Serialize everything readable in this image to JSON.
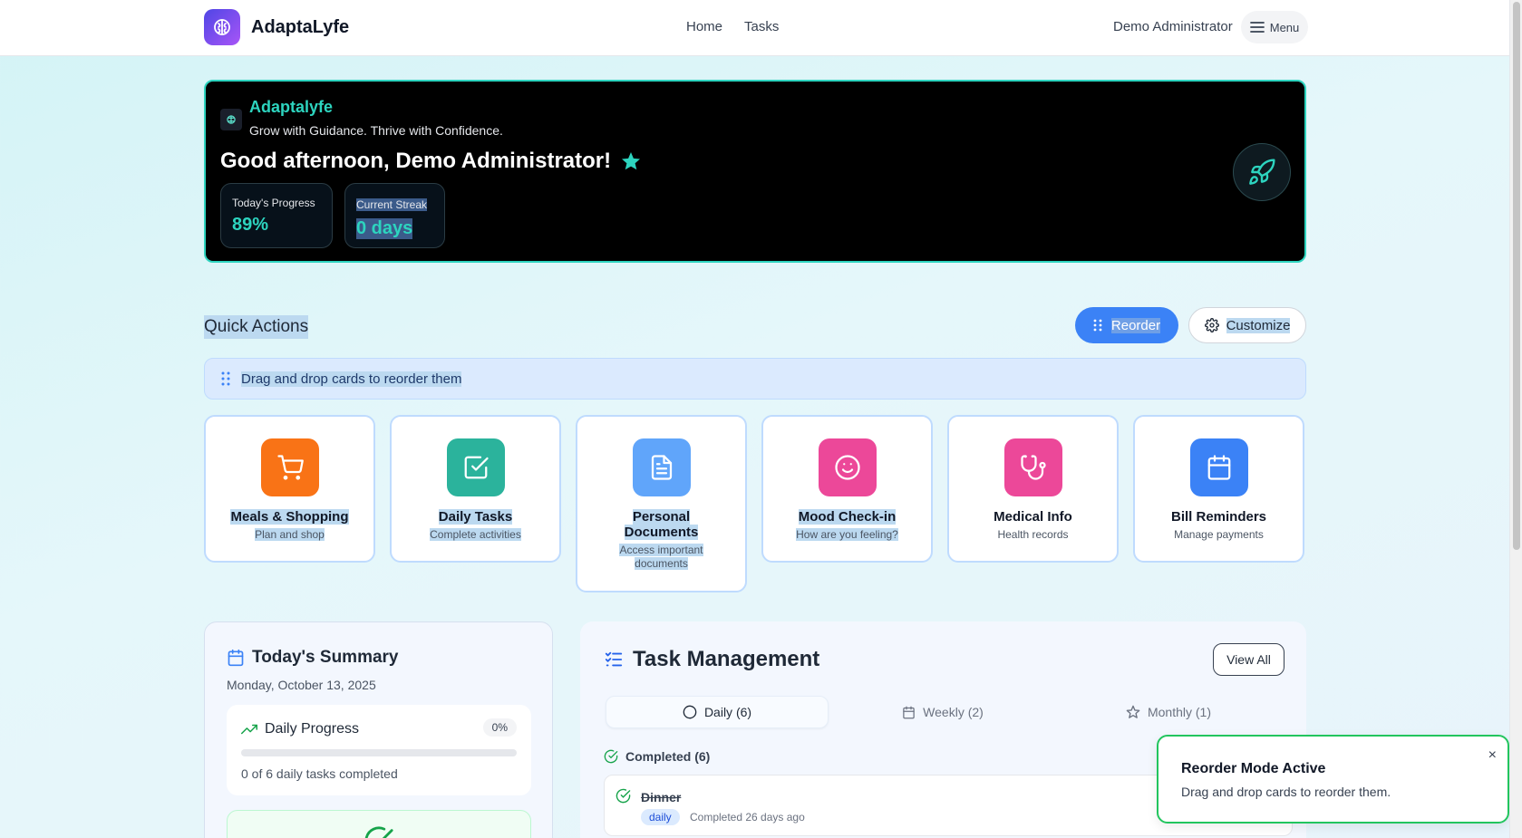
{
  "nav": {
    "brand": "AdaptaLyfe",
    "links": [
      "Home",
      "Tasks"
    ],
    "user": "Demo Administrator",
    "menu_label": "Menu"
  },
  "hero": {
    "app_name": "Adaptalyfe",
    "tagline": "Grow with Guidance. Thrive with Confidence.",
    "greeting": "Good afternoon, Demo Administrator!",
    "stats": [
      {
        "label": "Today's Progress",
        "value": "89%"
      },
      {
        "label": "Current Streak",
        "value": "0 days"
      }
    ],
    "accent": "#2dd4bf"
  },
  "quick_actions": {
    "title": "Quick Actions",
    "reorder_label": "Reorder",
    "customize_label": "Customize",
    "drag_hint": "Drag and drop cards to reorder them",
    "cards": [
      {
        "title": "Meals & Shopping",
        "subtitle": "Plan and shop",
        "icon": "cart-icon",
        "color": "#f97316"
      },
      {
        "title": "Daily Tasks",
        "subtitle": "Complete activities",
        "icon": "checkbox-icon",
        "color": "#2bb39c"
      },
      {
        "title": "Personal Documents",
        "subtitle": "Access important documents",
        "icon": "document-icon",
        "color": "#60a5fa"
      },
      {
        "title": "Mood Check-in",
        "subtitle": "How are you feeling?",
        "icon": "smile-icon",
        "color": "#ec4899"
      },
      {
        "title": "Medical Info",
        "subtitle": "Health records",
        "icon": "stethoscope-icon",
        "color": "#ec4899"
      },
      {
        "title": "Bill Reminders",
        "subtitle": "Manage payments",
        "icon": "calendar-icon",
        "color": "#3b82f6"
      }
    ]
  },
  "summary": {
    "title": "Today's Summary",
    "date": "Monday, October 13, 2025",
    "progress_title": "Daily Progress",
    "progress_pct": "0%",
    "progress_value": 0,
    "progress_caption": "0 of 6 daily tasks completed"
  },
  "tasks": {
    "title": "Task Management",
    "view_all": "View All",
    "tabs": [
      "Daily (6)",
      "Weekly (2)",
      "Monthly (1)"
    ],
    "completed_header": "Completed (6)",
    "items": [
      {
        "name": "Dinner",
        "tag": "daily",
        "meta": "Completed 26 days ago"
      }
    ]
  },
  "toast": {
    "title": "Reorder Mode Active",
    "message": "Drag and drop cards to reorder them.",
    "close": "×"
  }
}
